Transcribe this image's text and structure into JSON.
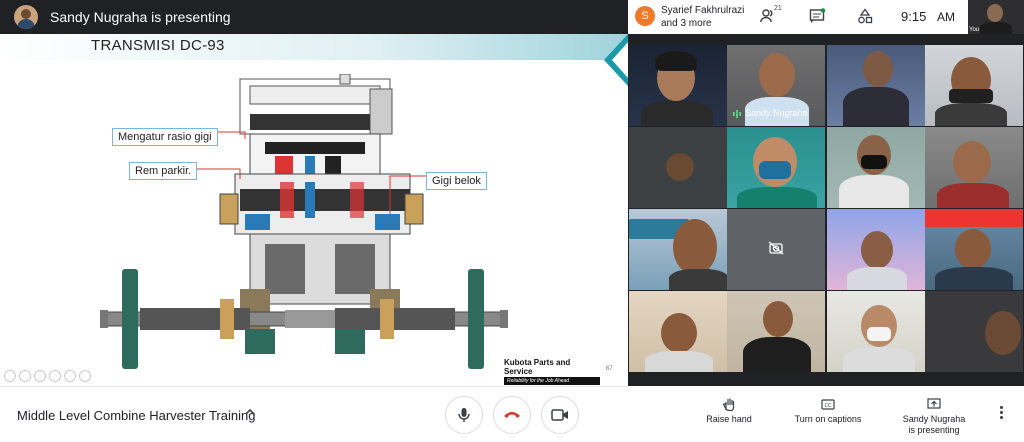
{
  "presenter_bar": {
    "title": "Sandy Nugraha is presenting"
  },
  "slide": {
    "title": "TRANSMISI DC-93",
    "callouts": {
      "ratio": "Mengatur rasio gigi",
      "brake": "Rem parkir.",
      "turn": "Gigi belok"
    },
    "brand_name": "Kubota Parts and Service",
    "brand_tagline": "Reliability for the Job Ahead",
    "page_number": "67"
  },
  "bottom_left": {
    "meeting_title": "Middle Level Combine Harvester Training"
  },
  "top_right": {
    "presenter_initial": "S",
    "presenters_line1": "Syarief Fakhrulrazi",
    "presenters_line2": "and 3 more",
    "people_count": "21",
    "time": "9:15",
    "ampm": "AM",
    "self_label": "You"
  },
  "grid": {
    "speaker_label": "Sandy Nugraha"
  },
  "bottom_right": {
    "raise_hand": "Raise hand",
    "captions": "Turn on captions",
    "presenting_line1": "Sandy Nugraha",
    "presenting_line2": "is presenting"
  },
  "colors": {
    "accent_teal": "#1a9aa8",
    "end_call_red": "#d93025",
    "callout_border": "#7bb6d6"
  }
}
